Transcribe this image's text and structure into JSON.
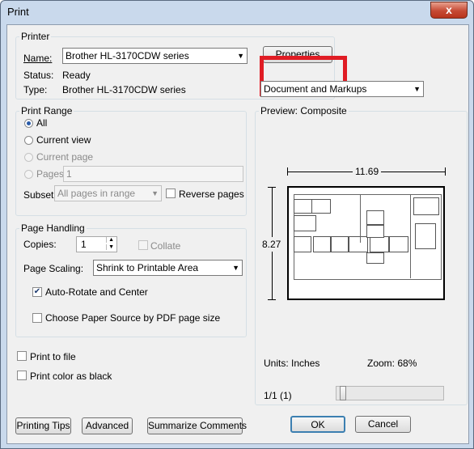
{
  "window": {
    "title": "Print",
    "close_glyph": "x"
  },
  "printer": {
    "group_label": "Printer",
    "name_label": "Name:",
    "name_value": "Brother HL-3170CDW series",
    "status_label": "Status:",
    "status_value": "Ready",
    "type_label": "Type:",
    "type_value": "Brother HL-3170CDW series",
    "properties_button": "Properties",
    "comments_value": "Document and Markups"
  },
  "print_range": {
    "group_label": "Print Range",
    "all": "All",
    "current_view": "Current view",
    "current_page": "Current page",
    "pages": "Pages",
    "pages_value": "1",
    "subset_label": "Subset:",
    "subset_value": "All pages in range",
    "reverse_pages": "Reverse pages"
  },
  "page_handling": {
    "group_label": "Page Handling",
    "copies_label": "Copies:",
    "copies_value": "1",
    "collate": "Collate",
    "scaling_label": "Page Scaling:",
    "scaling_value": "Shrink to Printable Area",
    "auto_rotate": "Auto-Rotate and Center",
    "paper_source": "Choose Paper Source by PDF page size"
  },
  "options": {
    "print_to_file": "Print to file",
    "print_color_black": "Print color as black"
  },
  "preview": {
    "group_label": "Preview: Composite",
    "width_dim": "11.69",
    "height_dim": "8.27",
    "units": "Units: Inches",
    "zoom": "Zoom:  68%",
    "page_indicator": "1/1 (1)"
  },
  "buttons": {
    "printing_tips": "Printing Tips",
    "advanced": "Advanced",
    "summarize_comments": "Summarize Comments",
    "ok": "OK",
    "cancel": "Cancel"
  },
  "colors": {
    "highlight": "#e01c24",
    "title_bar": "#c9d9ec",
    "close_button": "#c64a34"
  }
}
